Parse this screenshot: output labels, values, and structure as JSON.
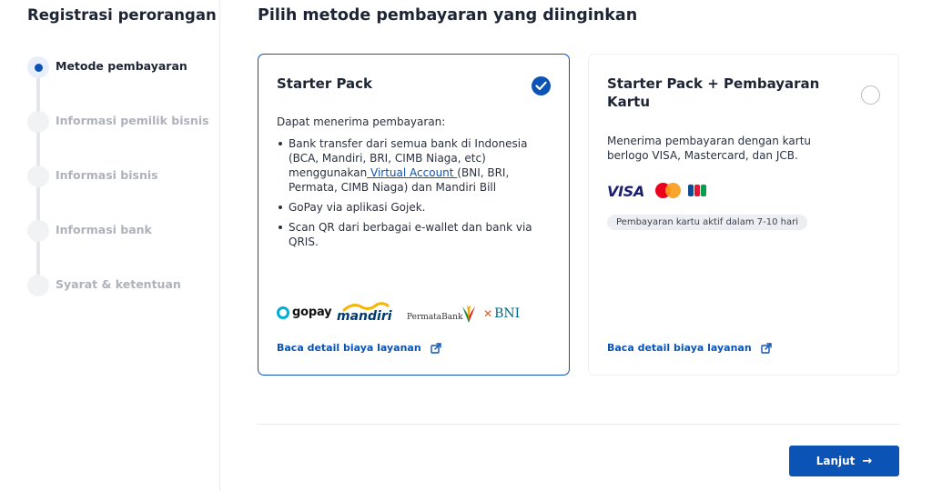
{
  "sidebar": {
    "title": "Registrasi perorangan",
    "steps": [
      {
        "label": "Metode pembayaran",
        "active": true
      },
      {
        "label": "Informasi pemilik bisnis",
        "active": false
      },
      {
        "label": "Informasi bisnis",
        "active": false
      },
      {
        "label": "Informasi bank",
        "active": false
      },
      {
        "label": "Syarat & ketentuan",
        "active": false
      }
    ]
  },
  "main": {
    "title": "Pilih metode pembayaran yang diinginkan",
    "options": [
      {
        "title": "Starter Pack",
        "selected": true,
        "description": "Dapat menerima pembayaran:",
        "features": [
          {
            "before_link": "Bank transfer dari semua bank di Indonesia (BCA, Mandiri, BRI, CIMB Niaga, etc) menggunakan",
            "link": " Virtual Account ",
            "after_link": "(BNI, BRI, Permata, CIMB Niaga) dan Mandiri Bill"
          },
          {
            "text": "GoPay via aplikasi Gojek."
          },
          {
            "text": "Scan QR dari berbagai e-wallet dan bank via QRIS."
          }
        ],
        "logos": {
          "gopay": "gopay",
          "mandiri": "mandiri",
          "permata": "PermataBank",
          "bni": "BNI"
        },
        "detail_link": "Baca detail biaya layanan"
      },
      {
        "title": "Starter Pack + Pembayaran Kartu",
        "selected": false,
        "description": "Menerima pembayaran dengan kartu berlogo VISA, Mastercard, dan JCB.",
        "logos": {
          "visa": "VISA"
        },
        "badge": "Pembayaran kartu aktif dalam 7-10 hari",
        "detail_link": "Baca detail biaya layanan"
      }
    ]
  },
  "footer": {
    "next_label": "Lanjut",
    "next_icon": "arrow-right-icon"
  },
  "colors": {
    "primary": "#0b53b4",
    "text": "#1d2433",
    "muted": "#aeb2bb"
  }
}
